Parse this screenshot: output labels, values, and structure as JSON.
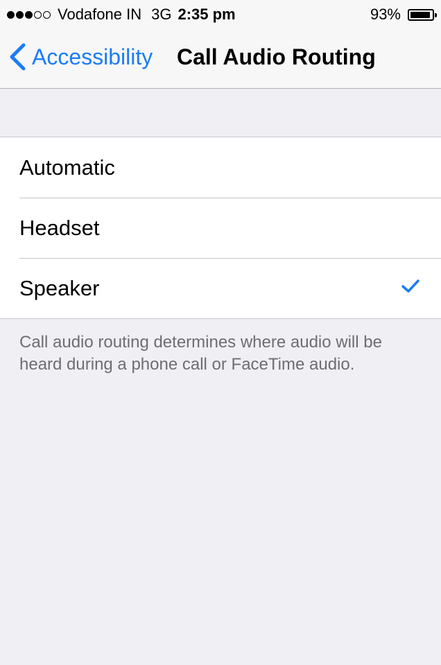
{
  "status_bar": {
    "signal_full": 3,
    "signal_empty": 2,
    "carrier": "Vodafone IN",
    "network": "3G",
    "time": "2:35 pm",
    "battery_percent": "93%",
    "battery_level": 0.93
  },
  "nav": {
    "back_label": "Accessibility",
    "title": "Call Audio Routing",
    "accent_color": "#1a7cf5"
  },
  "options": [
    {
      "label": "Automatic",
      "selected": false
    },
    {
      "label": "Headset",
      "selected": false
    },
    {
      "label": "Speaker",
      "selected": true
    }
  ],
  "footer_note": "Call audio routing determines where audio will be heard during a phone call or FaceTime audio."
}
